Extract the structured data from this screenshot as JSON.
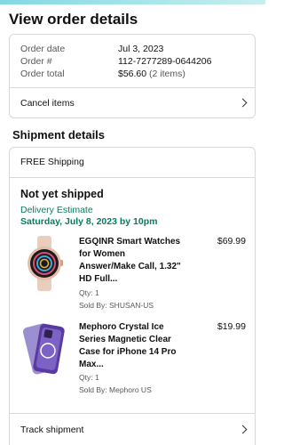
{
  "page": {
    "title": "View order details"
  },
  "summary": {
    "order_date_label": "Order date",
    "order_date": "Jul 3, 2023",
    "order_number_label": "Order #",
    "order_number": "112-7277289-0644206",
    "order_total_label": "Order total",
    "order_total": "$56.60",
    "item_count": "(2 items)",
    "cancel_label": "Cancel items"
  },
  "shipment": {
    "section_title": "Shipment details",
    "shipping_type": "FREE Shipping",
    "status": "Not yet shipped",
    "estimate_label": "Delivery Estimate",
    "estimate_date": "Saturday, July 8, 2023 by 10pm",
    "items": [
      {
        "title_lines": [
          "EGQINR Smart Watches",
          "for Women",
          "Answer/Make Call, 1.32\"",
          "HD Full..."
        ],
        "price": "$69.99",
        "qty": "Qty: 1",
        "sold_by": "Sold By: SHUSAN-US",
        "icon": "smartwatch-image"
      },
      {
        "title_lines": [
          "Mephoro Crystal Ice",
          "Series Magnetic Clear",
          "Case for iPhone 14 Pro",
          "Max..."
        ],
        "price": "$19.99",
        "qty": "Qty: 1",
        "sold_by": "Sold By: Mephoro US",
        "icon": "phone-case-image"
      }
    ],
    "track_label": "Track shipment"
  },
  "colors": {
    "green": "#067d62",
    "border": "#d5d9d9",
    "muted": "#565959"
  }
}
